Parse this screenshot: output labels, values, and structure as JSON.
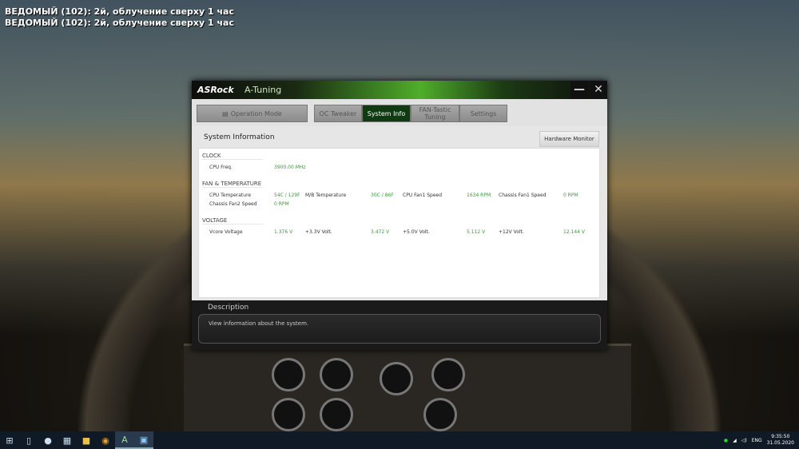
{
  "overlay": {
    "lines": [
      "ВЕДОМЫЙ (102): 2й, облучение сверху  1 час",
      "ВЕДОМЫЙ (102): 2й, облучение сверху  1 час"
    ]
  },
  "window": {
    "brand": "ASRock",
    "title": "A-Tuning",
    "minimize": "—",
    "close": "✕"
  },
  "tabs": {
    "operation_mode": "Operation Mode",
    "oc_tweaker": "OC Tweaker",
    "system_info": "System Info",
    "fan_tastic": "FAN-Tastic Tuning",
    "settings": "Settings"
  },
  "section_title": "System Information",
  "hardware_monitor": "Hardware Monitor",
  "clock": {
    "heading": "CLOCK",
    "cpu_freq_label": "CPU Freq.",
    "cpu_freq": "3900.00 MHz"
  },
  "fan": {
    "heading": "FAN & TEMPERATURE",
    "cpu_temp_label": "CPU Temperature",
    "cpu_temp": "54C / 129F",
    "mb_temp_label": "M/B Temperature",
    "mb_temp": "30C / 86F",
    "cpu_fan1_label": "CPU Fan1 Speed",
    "cpu_fan1": "1634 RPM",
    "chassis_fan1_label": "Chassis Fan1 Speed",
    "chassis_fan1": "0 RPM",
    "chassis_fan2_label": "Chassis Fan2 Speed",
    "chassis_fan2": "0 RPM"
  },
  "voltage": {
    "heading": "VOLTAGE",
    "vcore_label": "Vcore Voltage",
    "vcore": "1.376 V",
    "v33_label": "+3.3V Volt.",
    "v33": "3.472 V",
    "v50_label": "+5.0V Volt.",
    "v50": "5.112 V",
    "v12_label": "+12V Volt.",
    "v12": "12.144 V"
  },
  "description": {
    "heading": "Description",
    "text": "View information about the system."
  },
  "taskbar": {
    "start": "⊞",
    "lang": "ENG",
    "time": "9:35:50",
    "date": "31.05.2020"
  },
  "colors": {
    "accent": "#0f3a12",
    "value_green": "#3c9a3c"
  }
}
